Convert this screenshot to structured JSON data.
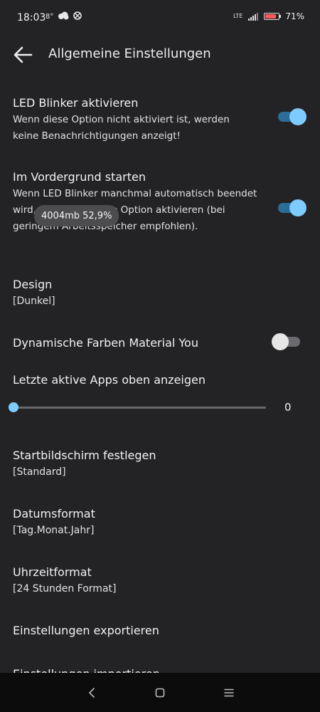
{
  "status_bar": {
    "time": "18:03",
    "temp": "8°",
    "network": "LTE",
    "battery_percent": "71%",
    "battery_level": 0.71,
    "icons": [
      "cloud-icon",
      "xbox-icon",
      "signal-icon",
      "battery-icon"
    ]
  },
  "app_bar": {
    "title": "Allgemeine Einstellungen",
    "back_icon": "arrow-back-icon"
  },
  "settings": {
    "led_blinker": {
      "title": "LED Blinker aktivieren",
      "description": "Wenn diese Option nicht aktiviert ist, werden keine Benachrichtigungen anzeigt!",
      "enabled": true
    },
    "foreground": {
      "title": "Im Vordergrund starten",
      "description": "Wenn LED Blinker manchmal automatisch beendet wird, sollten Sie diese Option aktivieren (bei geringem Arbeitsspeicher empfohlen).",
      "enabled": true
    },
    "design": {
      "title": "Design",
      "value": "[Dunkel]"
    },
    "material_you": {
      "title": "Dynamische Farben Material You",
      "enabled": false
    },
    "recent_apps": {
      "title": "Letzte aktive Apps oben anzeigen",
      "value": "0",
      "slider_fraction": 0
    },
    "home_screen": {
      "title": "Startbildschirm festlegen",
      "value": "[Standard]"
    },
    "date_format": {
      "title": "Datumsformat",
      "value": "[Tag.Monat.Jahr]"
    },
    "time_format": {
      "title": "Uhrzeitformat",
      "value": "[24 Stunden Format]"
    },
    "export": {
      "title": "Einstellungen exportieren"
    },
    "import": {
      "title": "Einstellungen importieren"
    }
  },
  "memory_toast": {
    "text": "4004mb 52,9%"
  },
  "colors": {
    "background": "#232326",
    "accent": "#7ecbfd",
    "accent_track": "#2a6e96",
    "nav_bar": "#0c0c0d"
  },
  "nav_bar": {
    "buttons": [
      "back-nav-icon",
      "home-nav-icon",
      "recents-nav-icon"
    ]
  }
}
